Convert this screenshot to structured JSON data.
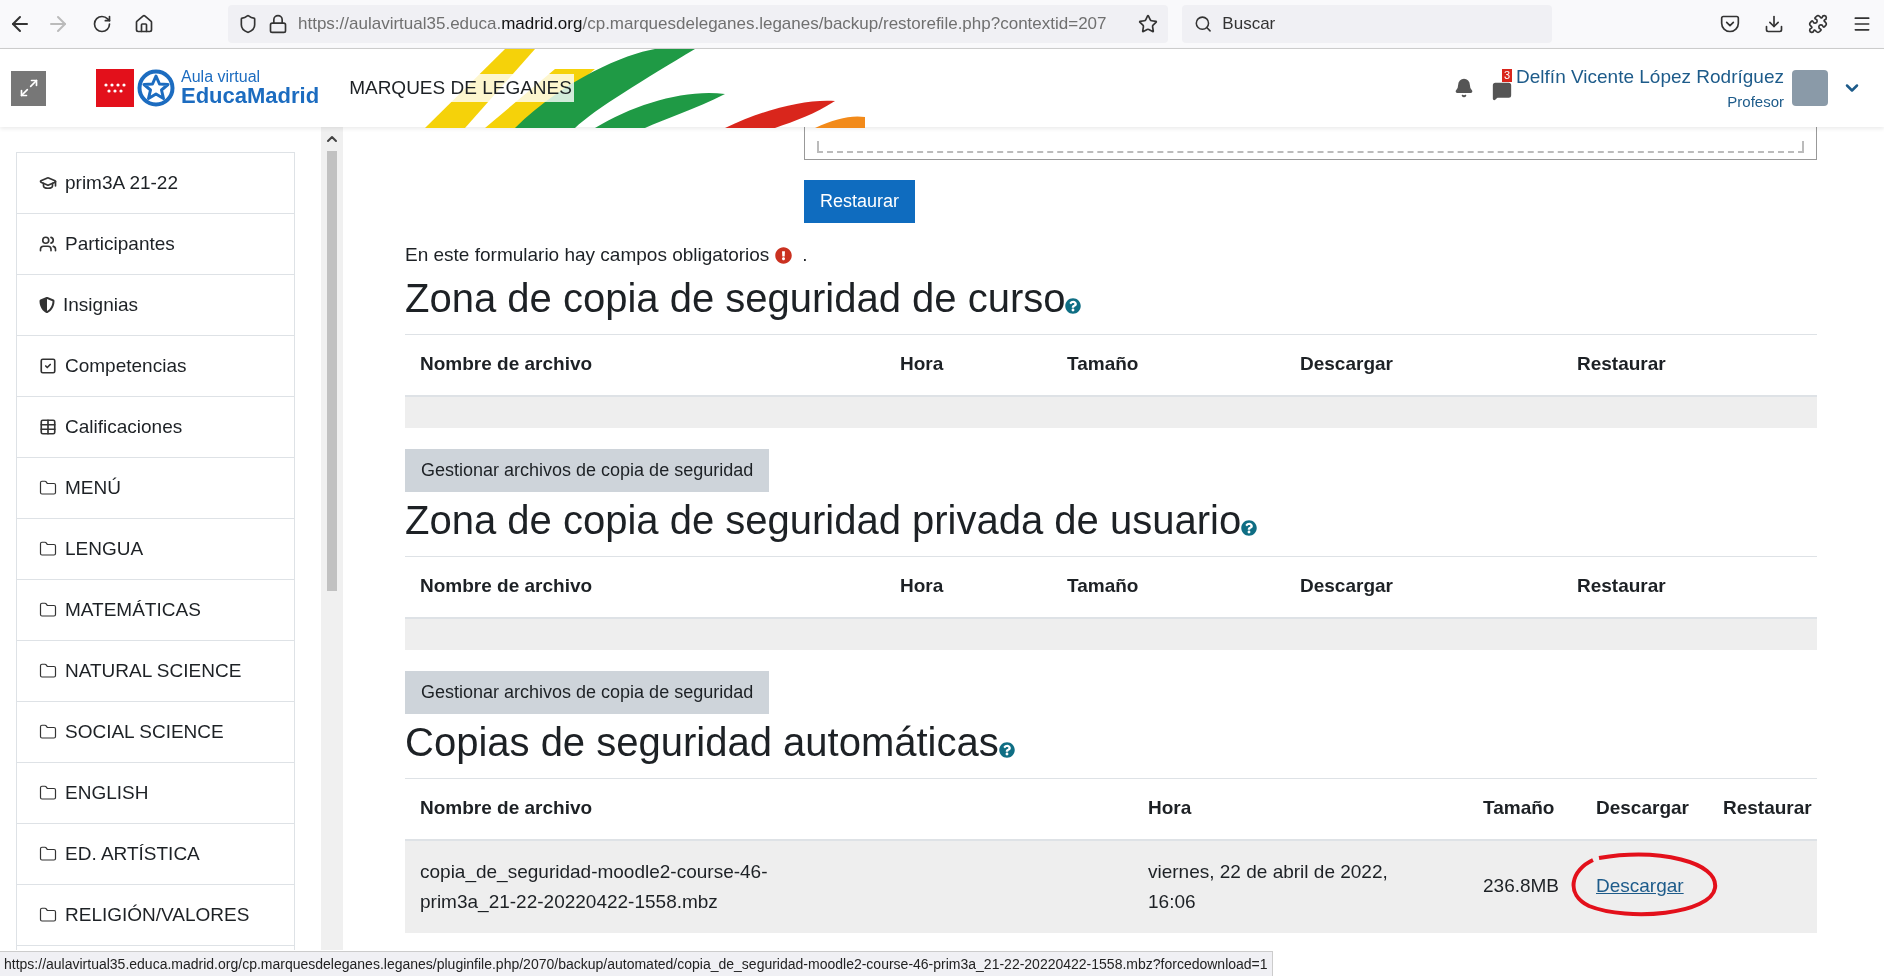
{
  "browser": {
    "url_start": "https://aulavirtual35.educa.",
    "url_domain": "madrid.org",
    "url_end": "/cp.marquesdeleganes.leganes/backup/restorefile.php?contextid=207",
    "back_disabled": false,
    "forward_disabled": true,
    "search_placeholder": "Buscar"
  },
  "header": {
    "logo_top": "Aula virtual",
    "logo_bottom": "EducaMadrid",
    "site_name": "MARQUES DE LEGANES",
    "message_count": "3",
    "user_name": "Delfín Vicente López Rodríguez",
    "user_role": "Profesor"
  },
  "sidebar": {
    "items": [
      {
        "label": "prim3A 21-22",
        "kind": "course"
      },
      {
        "label": "Participantes",
        "kind": "users"
      },
      {
        "label": "Insignias",
        "kind": "badge"
      },
      {
        "label": "Competencias",
        "kind": "check"
      },
      {
        "label": "Calificaciones",
        "kind": "table"
      },
      {
        "label": "MENÚ",
        "kind": "folder"
      },
      {
        "label": "LENGUA",
        "kind": "folder"
      },
      {
        "label": "MATEMÁTICAS",
        "kind": "folder"
      },
      {
        "label": "NATURAL SCIENCE",
        "kind": "folder"
      },
      {
        "label": "SOCIAL SCIENCE",
        "kind": "folder"
      },
      {
        "label": "ENGLISH",
        "kind": "folder"
      },
      {
        "label": "ED. ARTÍSTICA",
        "kind": "folder"
      },
      {
        "label": "RELIGIÓN/VALORES",
        "kind": "folder"
      }
    ]
  },
  "restore_button": "Restaurar",
  "required_note": "En este formulario hay campos obligatorios",
  "required_note_end": ".",
  "sections": [
    {
      "title": "Zona de copia de seguridad de curso",
      "columns": [
        "Nombre de archivo",
        "Hora",
        "Tamaño",
        "Descargar",
        "Restaurar"
      ],
      "manage_button": "Gestionar archivos de copia de seguridad"
    },
    {
      "title": "Zona de copia de seguridad privada de usuario",
      "columns": [
        "Nombre de archivo",
        "Hora",
        "Tamaño",
        "Descargar",
        "Restaurar"
      ],
      "manage_button": "Gestionar archivos de copia de seguridad"
    },
    {
      "title": "Copias de seguridad automáticas",
      "columns": [
        "Nombre de archivo",
        "Hora",
        "Tamaño",
        "Descargar",
        "Restaurar"
      ],
      "rows": [
        {
          "file": "copia_de_seguridad-moodle2-course-46-prim3a_21-22-20220422-1558.mbz",
          "time": "viernes, 22 de abril de 2022, 16:06",
          "size": "236.8MB",
          "download": "Descargar",
          "circled": true
        }
      ]
    }
  ],
  "status_url": "https://aulavirtual35.educa.madrid.org/cp.marquesdeleganes.leganes/pluginfile.php/2070/backup/automated/copia_de_seguridad-moodle2-course-46-prim3a_21-22-20220422-1558.mbz?forcedownload=1"
}
